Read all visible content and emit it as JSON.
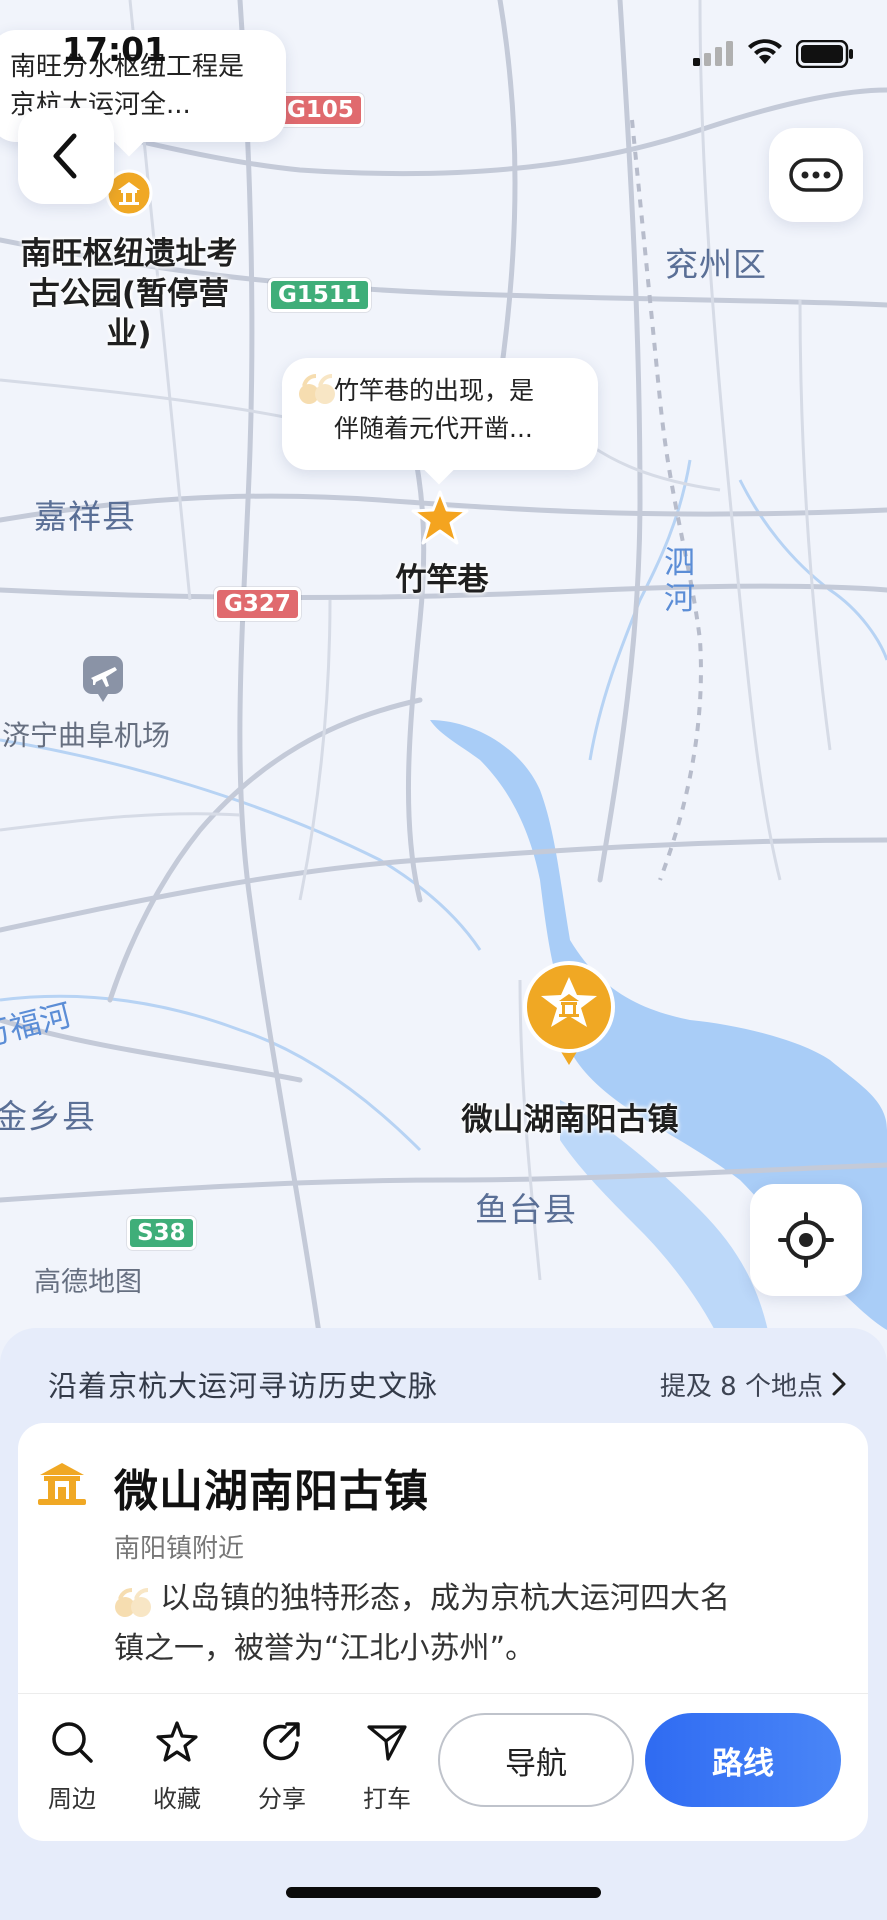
{
  "status_bar": {
    "time": "17:01"
  },
  "map": {
    "cities": [
      "兖州区",
      "嘉祥县",
      "鱼台县",
      "金乡县"
    ],
    "rivers": [
      "泗河",
      "万福河"
    ],
    "roads": [
      "G105",
      "G1511",
      "G327",
      "S38"
    ],
    "airport": "济宁曲阜机场",
    "attribution": "高德地图",
    "pois": [
      {
        "name": "南旺枢纽遗址考古公园(暂停营业)",
        "icon": "pavilion-icon"
      },
      {
        "name": "竹竿巷",
        "icon": "star-icon"
      },
      {
        "name": "微山湖南阳古镇",
        "icon": "pavilion-icon",
        "selected": true
      }
    ],
    "bubbles": [
      {
        "text": "南旺分水枢纽工程是京杭大运河全..."
      },
      {
        "text_line1": "竹竿巷的出现，是",
        "text_line2": "伴随着元代开凿..."
      }
    ]
  },
  "sheet": {
    "route_title": "沿着京杭大运河寻访历史文脉",
    "mentions": "提及 8 个地点",
    "place_name": "微山湖南阳古镇",
    "place_sub": "南阳镇附近",
    "desc_line1": "以岛镇的独特形态，成为京杭大运河四大名",
    "desc_line2": "镇之一，被誉为“江北小苏州”。",
    "actions": [
      "周边",
      "收藏",
      "分享",
      "打车"
    ],
    "nav_label": "导航",
    "route_label": "路线"
  },
  "colors": {
    "accent": "#2f6bf2",
    "poi_orange": "#f0a824",
    "water": "#a9cdf7",
    "map_bg": "#f1f4fb"
  }
}
